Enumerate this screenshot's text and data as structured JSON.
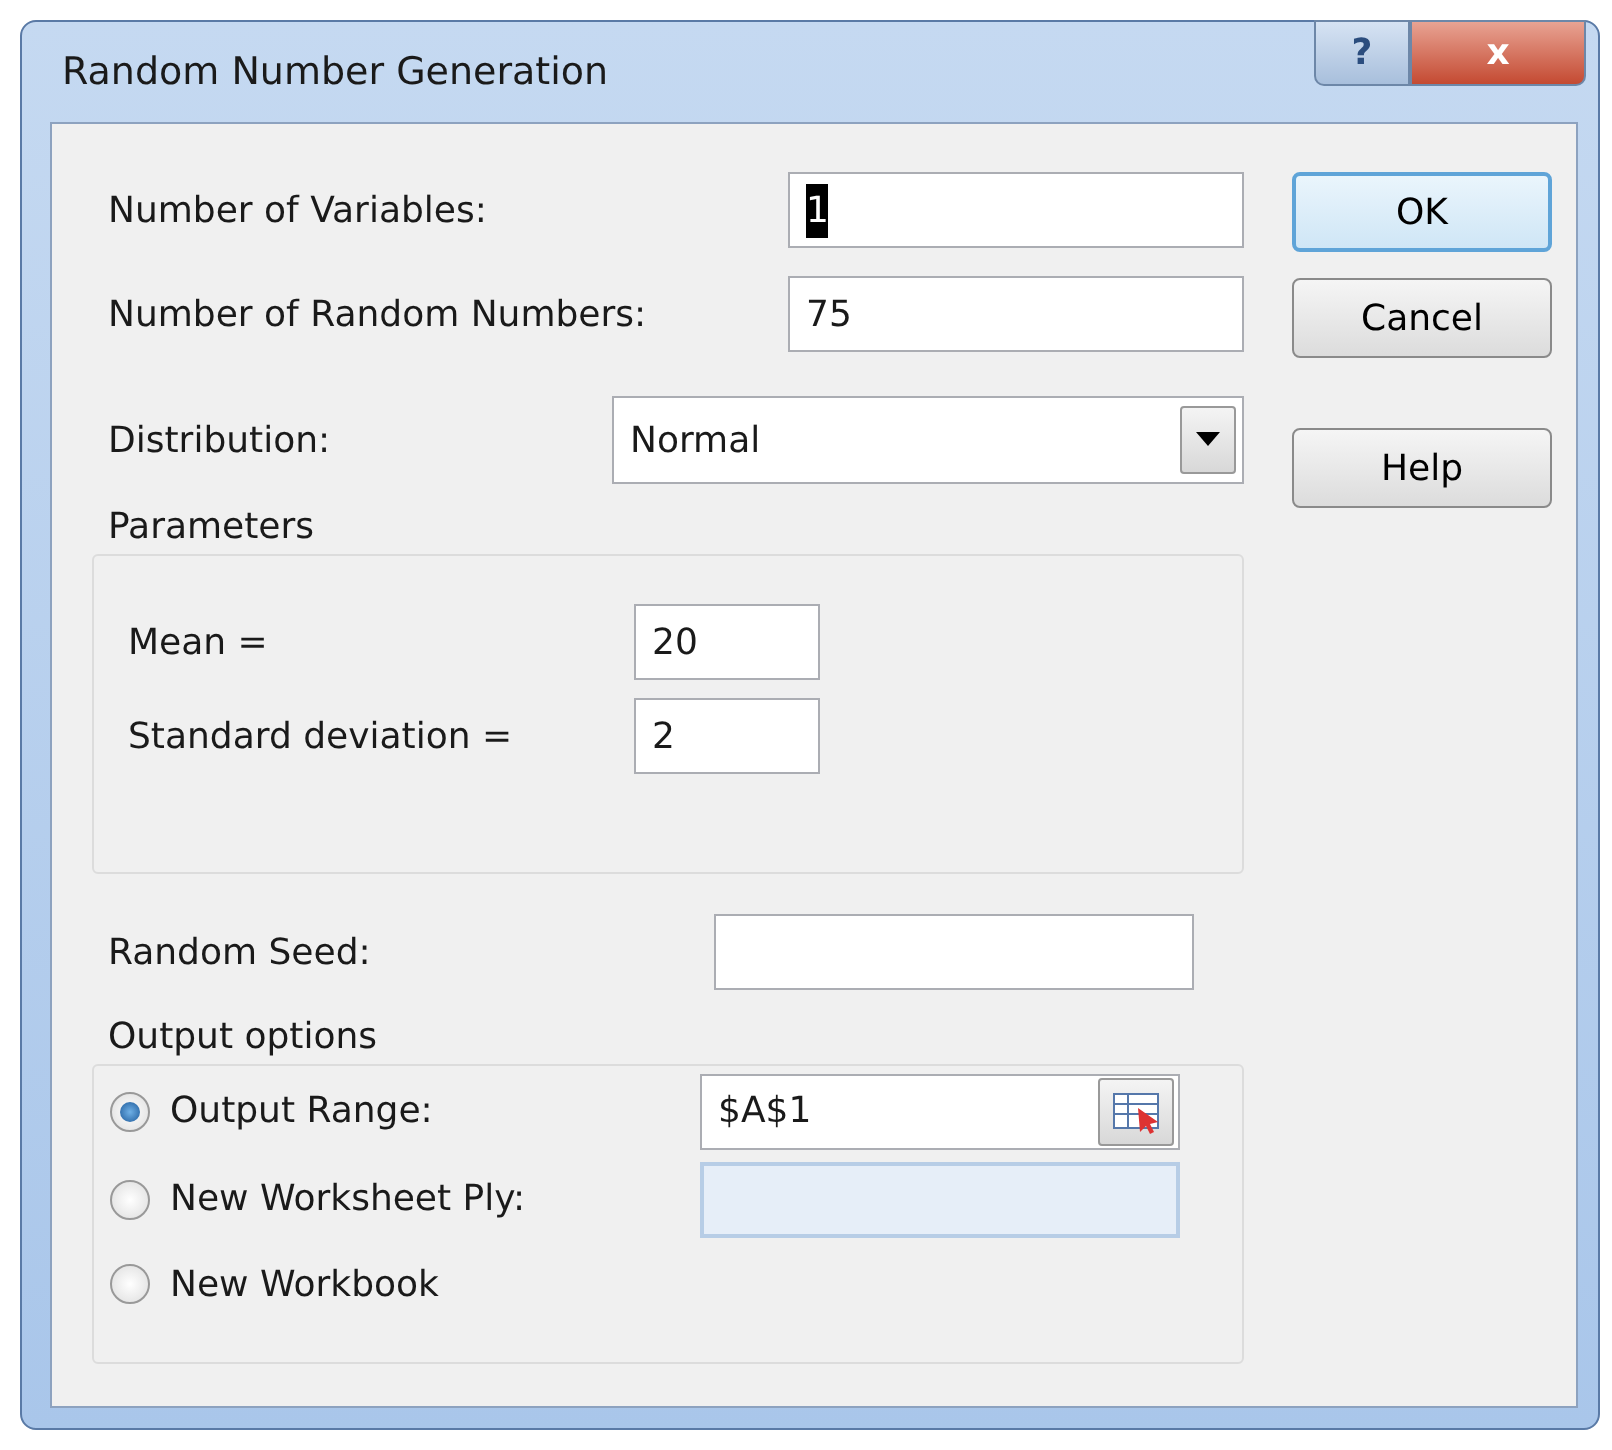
{
  "window": {
    "title": "Random Number Generation",
    "title_buttons": [
      {
        "kind": "help",
        "label": "?"
      },
      {
        "kind": "close",
        "label": "x"
      }
    ]
  },
  "fields": [
    {
      "label": "Number of Variables:",
      "value": "1",
      "text_selected": true
    },
    {
      "label": "Number of Random Numbers:",
      "value": "75",
      "text_selected": false
    }
  ],
  "distribution": {
    "label": "Distribution:",
    "value": "Normal"
  },
  "parameters": {
    "title": "Parameters",
    "fields": [
      {
        "label": "Mean =",
        "value": "20"
      },
      {
        "label": "Standard deviation =",
        "value": "2"
      }
    ]
  },
  "random_seed": {
    "label": "Random Seed:"
  },
  "output_options": {
    "title": "Output options",
    "options": [
      {
        "label": "Output Range:",
        "selected": true,
        "field": {
          "value": "$A$1",
          "disabled": false,
          "has_picker": true
        }
      },
      {
        "label": "New Worksheet Ply:",
        "selected": false,
        "field": {
          "disabled": true
        }
      },
      {
        "label": "New Workbook",
        "selected": false
      }
    ]
  },
  "buttons": [
    {
      "label": "OK",
      "default": true
    },
    {
      "label": "Cancel",
      "default": false
    },
    {
      "label": "Help",
      "default": false
    }
  ]
}
